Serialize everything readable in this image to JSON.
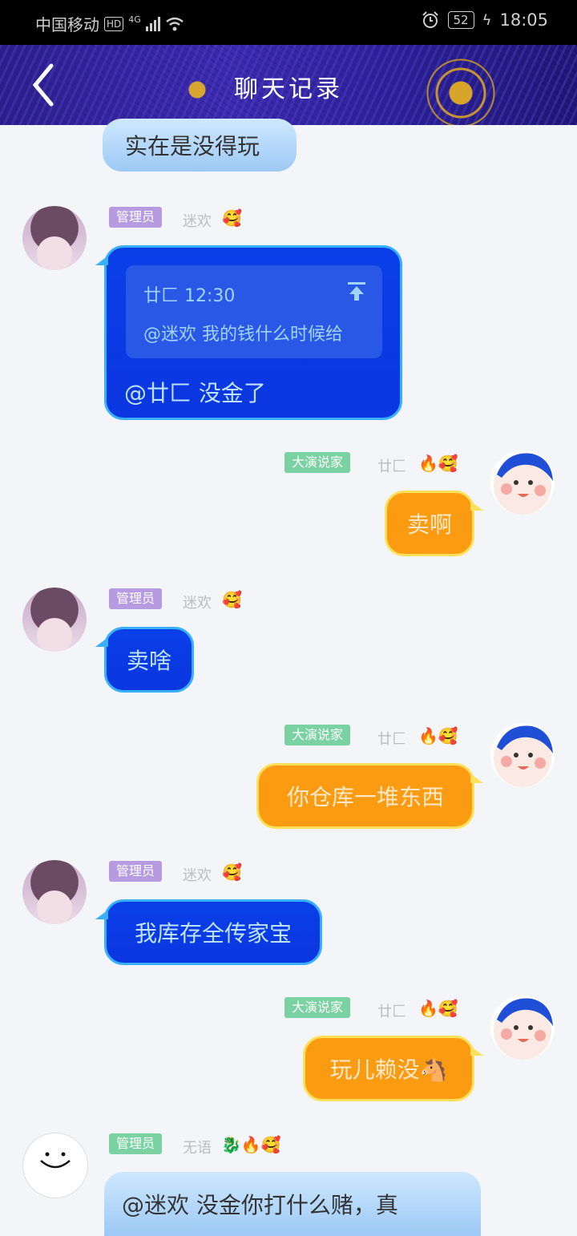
{
  "status_bar": {
    "carrier": "中国移动",
    "hd": "HD",
    "net": "4G",
    "battery": "52",
    "time": "18:05"
  },
  "header": {
    "title": "聊天记录"
  },
  "messages": [
    {
      "text": "实在是没得玩"
    },
    {
      "role": "管理员",
      "nick": "迷欢",
      "emojis": "🥰",
      "quote": {
        "author_time": "廿匚 12:30",
        "text": "@迷欢 我的钱什么时候给"
      },
      "text": "@廿匚 没金了"
    },
    {
      "role": "大演说家",
      "nick": "廿匚",
      "emojis": "🔥🥰",
      "text": "卖啊"
    },
    {
      "role": "管理员",
      "nick": "迷欢",
      "emojis": "🥰",
      "text": "卖啥"
    },
    {
      "role": "大演说家",
      "nick": "廿匚",
      "emojis": "🔥🥰",
      "text": "你仓库一堆东西"
    },
    {
      "role": "管理员",
      "nick": "迷欢",
      "emojis": "🥰",
      "text": "我库存全传家宝"
    },
    {
      "role": "大演说家",
      "nick": "廿匚",
      "emojis": "🔥🥰",
      "text": "玩儿赖没🐴"
    },
    {
      "role": "管理员",
      "nick": "无语",
      "emojis": "🐉🔥🥰",
      "text": "@迷欢 没金你打什么赌，真"
    }
  ],
  "colors": {
    "blue_bubble": "#0a3fe8",
    "orange_bubble": "#fb9b12",
    "admin_badge": "#b79be0",
    "speaker_badge": "#7ad1a1"
  },
  "icons": [
    "back-arrow-icon",
    "alarm-icon",
    "wifi-icon",
    "pin-top-icon"
  ]
}
